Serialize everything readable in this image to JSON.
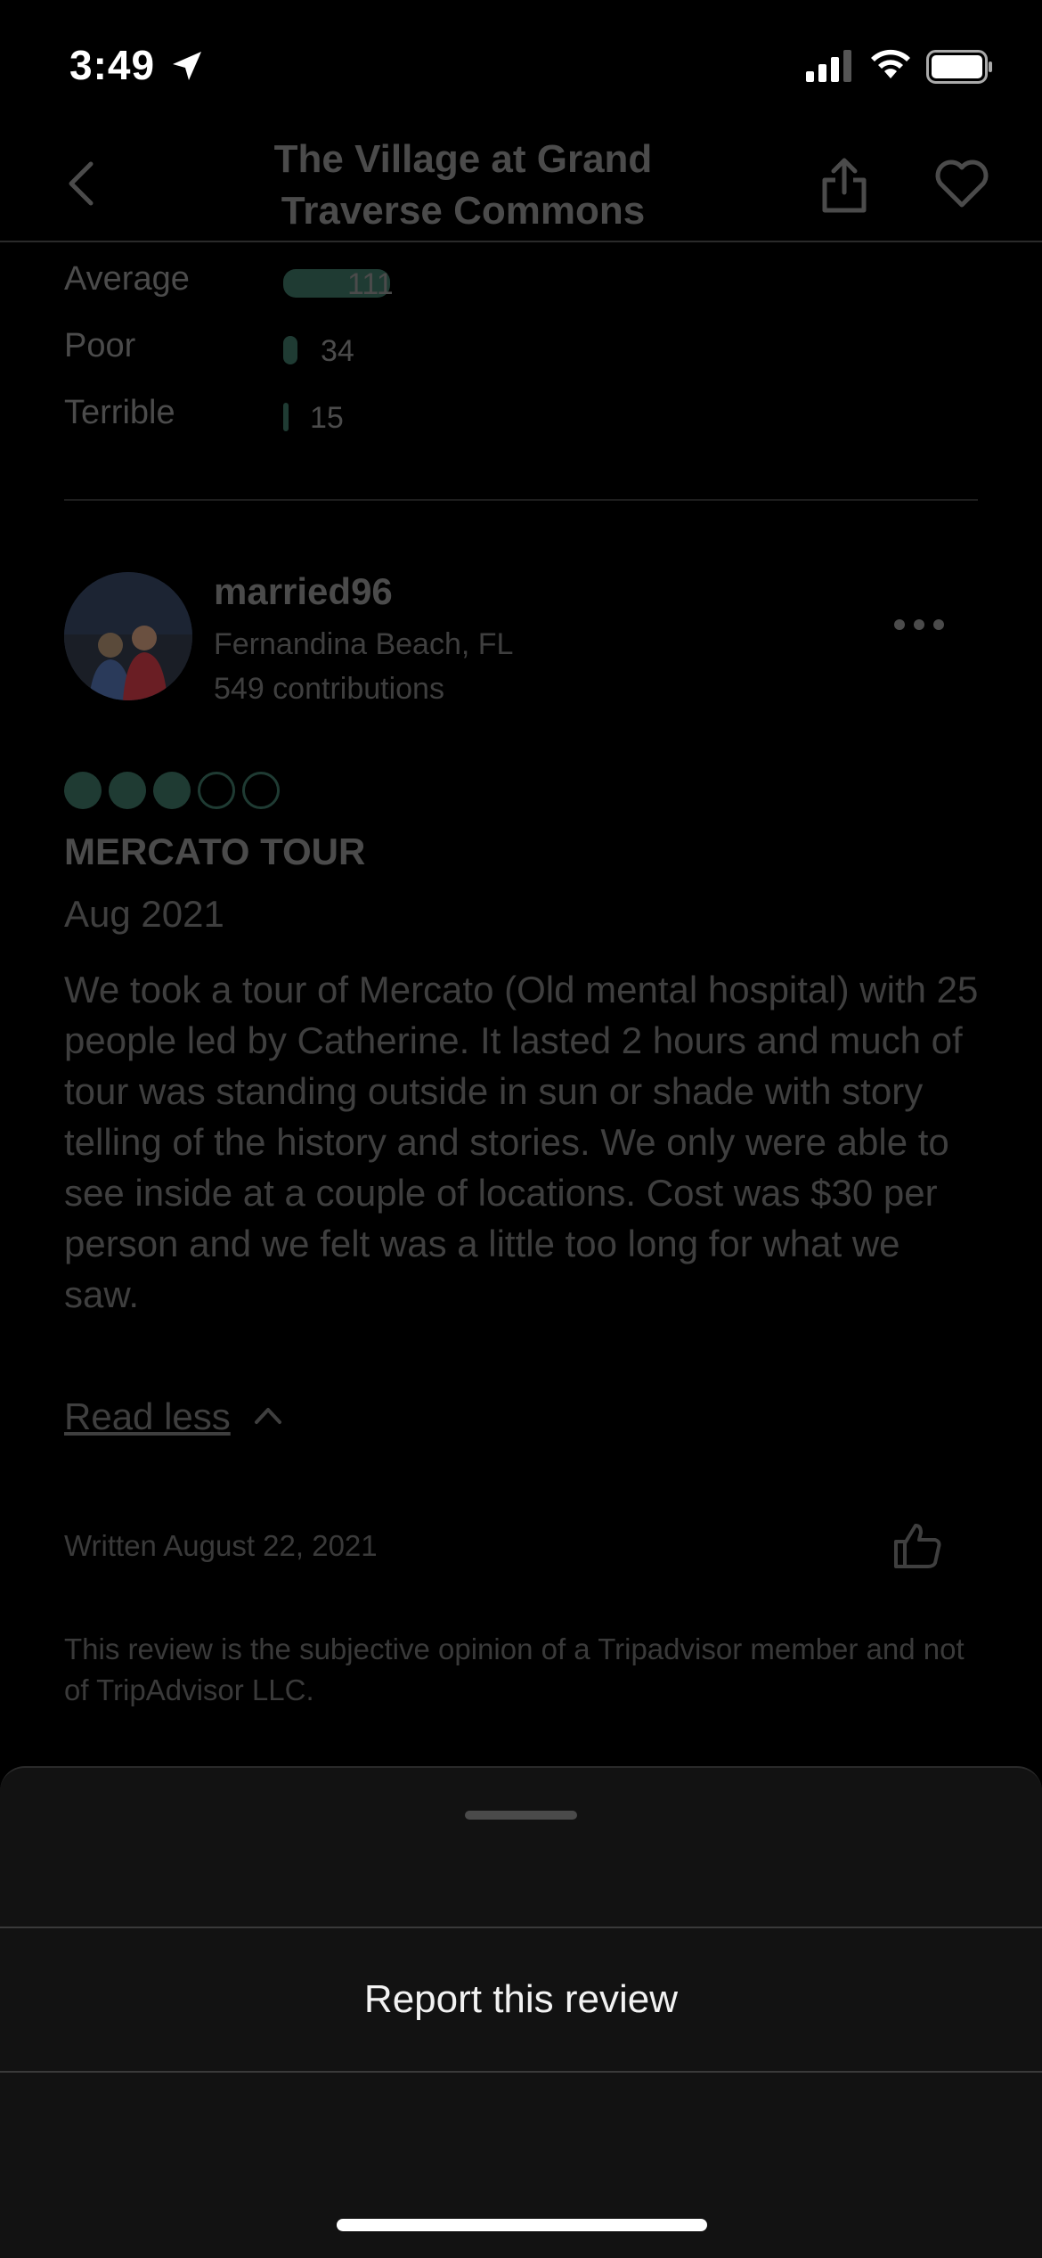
{
  "status_bar": {
    "time": "3:49"
  },
  "header": {
    "title_line1": "The Village at Grand",
    "title_line2": "Traverse Commons"
  },
  "ratings": [
    {
      "label": "Average",
      "count": "111"
    },
    {
      "label": "Poor",
      "count": "34"
    },
    {
      "label": "Terrible",
      "count": "15"
    }
  ],
  "review": {
    "reviewer_name": "married96",
    "reviewer_location": "Fernandina Beach, FL",
    "reviewer_contributions": "549 contributions",
    "bubble_rating": 3,
    "bubble_max": 5,
    "title": "MERCATO TOUR",
    "date": "Aug 2021",
    "body": "We took a tour of Mercato (Old mental hospital) with 25 people led by Catherine.  It lasted 2 hours and much of tour was standing outside in sun or shade with story telling of the history and stories.  We only were able to see inside at a couple of locations.  Cost was $30 per person and we felt was a little too long for what we saw.",
    "read_less": "Read less",
    "written": "Written August 22, 2021",
    "disclaimer": "This review is the subjective opinion of a Tripadvisor member and not of TripAdvisor LLC."
  },
  "sheet": {
    "report_label": "Report this review"
  },
  "colors": {
    "accent": "#1f3b33",
    "background": "#000000",
    "sheet": "#121212"
  },
  "icons": [
    "location-arrow-icon",
    "signal-icon",
    "wifi-icon",
    "battery-icon",
    "back-chevron-icon",
    "share-icon",
    "heart-icon",
    "more-icon",
    "chevron-up-icon",
    "thumbs-up-icon"
  ]
}
